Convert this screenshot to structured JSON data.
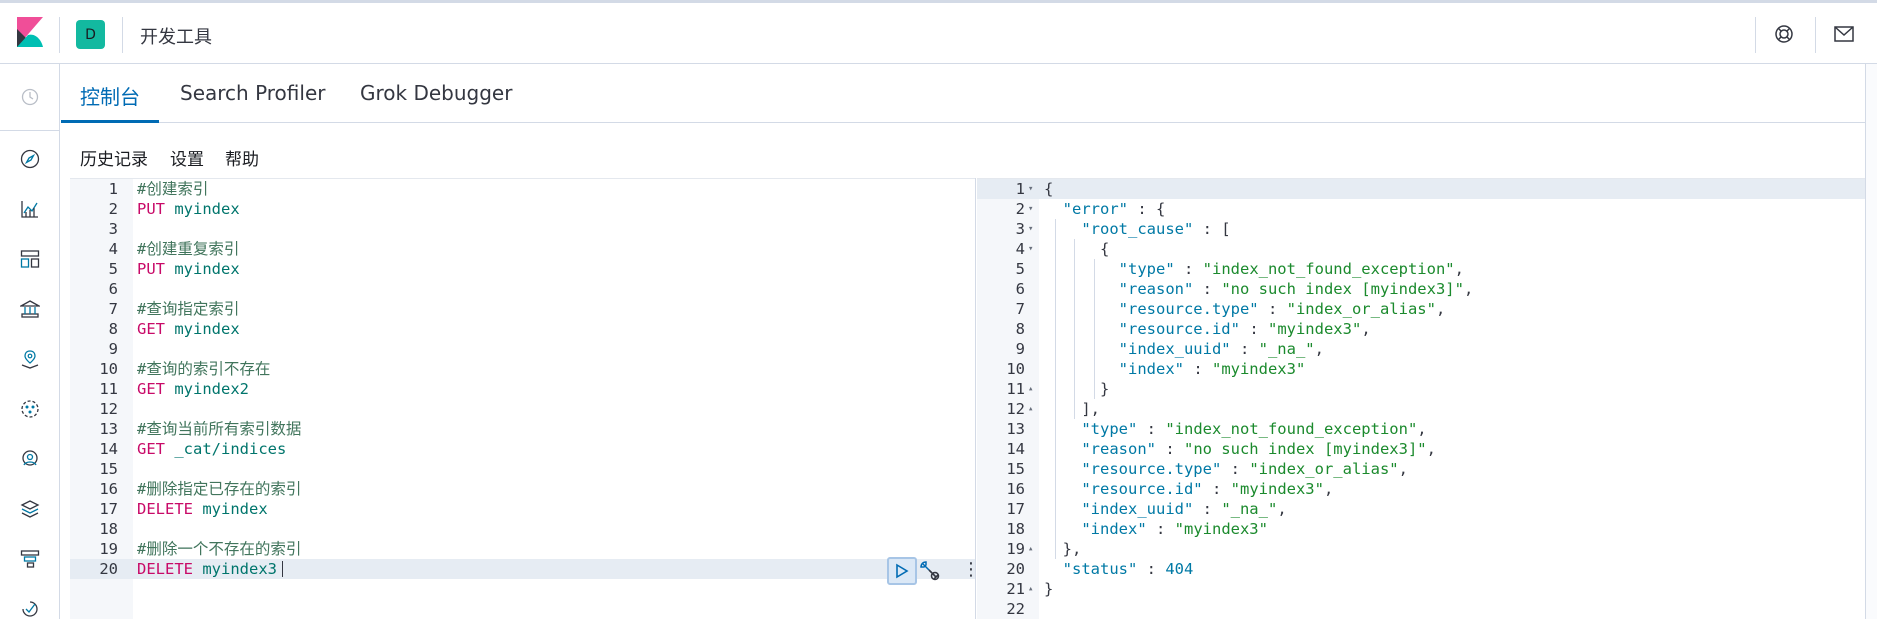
{
  "header": {
    "space_initial": "D",
    "app_title": "开发工具"
  },
  "tabs": [
    {
      "label": "控制台",
      "active": true
    },
    {
      "label": "Search Profiler",
      "active": false
    },
    {
      "label": "Grok Debugger",
      "active": false
    }
  ],
  "toolbar": {
    "history": "历史记录",
    "settings": "设置",
    "help": "帮助"
  },
  "request_editor": {
    "active_line": 20,
    "lines": [
      [
        {
          "t": "#创建索引",
          "c": "comment"
        }
      ],
      [
        {
          "t": "PUT",
          "c": "method"
        },
        {
          "t": " myindex",
          "c": "url"
        }
      ],
      [],
      [
        {
          "t": "#创建重复索引",
          "c": "comment"
        }
      ],
      [
        {
          "t": "PUT",
          "c": "method"
        },
        {
          "t": " myindex",
          "c": "url"
        }
      ],
      [],
      [
        {
          "t": "#查询指定索引",
          "c": "comment"
        }
      ],
      [
        {
          "t": "GET",
          "c": "method"
        },
        {
          "t": " myindex",
          "c": "url"
        }
      ],
      [],
      [
        {
          "t": "#查询的索引不存在",
          "c": "comment"
        }
      ],
      [
        {
          "t": "GET",
          "c": "method"
        },
        {
          "t": " myindex2",
          "c": "url"
        }
      ],
      [],
      [
        {
          "t": "#查询当前所有索引数据",
          "c": "comment"
        }
      ],
      [
        {
          "t": "GET",
          "c": "method"
        },
        {
          "t": " _cat/indices",
          "c": "url"
        }
      ],
      [],
      [
        {
          "t": "#删除指定已存在的索引",
          "c": "comment"
        }
      ],
      [
        {
          "t": "DELETE",
          "c": "method"
        },
        {
          "t": " myindex",
          "c": "url"
        }
      ],
      [],
      [
        {
          "t": "#删除一个不存在的索引",
          "c": "comment"
        }
      ],
      [
        {
          "t": "DELETE",
          "c": "method"
        },
        {
          "t": " myindex3",
          "c": "url"
        }
      ]
    ]
  },
  "response_editor": {
    "active_line": 1,
    "fold_markers": {
      "1": "▾",
      "2": "▾",
      "3": "▾",
      "4": "▾",
      "11": "▴",
      "12": "▴",
      "19": "▴",
      "21": "▴"
    },
    "lines": [
      [
        {
          "t": "{",
          "c": "punc"
        }
      ],
      [
        {
          "t": "  ",
          "c": "punc"
        },
        {
          "t": "\"error\"",
          "c": "key"
        },
        {
          "t": " : {",
          "c": "punc"
        }
      ],
      [
        {
          "t": "    ",
          "c": "punc"
        },
        {
          "t": "\"root_cause\"",
          "c": "key"
        },
        {
          "t": " : [",
          "c": "punc"
        }
      ],
      [
        {
          "t": "      {",
          "c": "punc"
        }
      ],
      [
        {
          "t": "        ",
          "c": "punc"
        },
        {
          "t": "\"type\"",
          "c": "key"
        },
        {
          "t": " : ",
          "c": "punc"
        },
        {
          "t": "\"index_not_found_exception\"",
          "c": "str"
        },
        {
          "t": ",",
          "c": "punc"
        }
      ],
      [
        {
          "t": "        ",
          "c": "punc"
        },
        {
          "t": "\"reason\"",
          "c": "key"
        },
        {
          "t": " : ",
          "c": "punc"
        },
        {
          "t": "\"no such index [myindex3]\"",
          "c": "str"
        },
        {
          "t": ",",
          "c": "punc"
        }
      ],
      [
        {
          "t": "        ",
          "c": "punc"
        },
        {
          "t": "\"resource.type\"",
          "c": "key"
        },
        {
          "t": " : ",
          "c": "punc"
        },
        {
          "t": "\"index_or_alias\"",
          "c": "str"
        },
        {
          "t": ",",
          "c": "punc"
        }
      ],
      [
        {
          "t": "        ",
          "c": "punc"
        },
        {
          "t": "\"resource.id\"",
          "c": "key"
        },
        {
          "t": " : ",
          "c": "punc"
        },
        {
          "t": "\"myindex3\"",
          "c": "str"
        },
        {
          "t": ",",
          "c": "punc"
        }
      ],
      [
        {
          "t": "        ",
          "c": "punc"
        },
        {
          "t": "\"index_uuid\"",
          "c": "key"
        },
        {
          "t": " : ",
          "c": "punc"
        },
        {
          "t": "\"_na_\"",
          "c": "str"
        },
        {
          "t": ",",
          "c": "punc"
        }
      ],
      [
        {
          "t": "        ",
          "c": "punc"
        },
        {
          "t": "\"index\"",
          "c": "key"
        },
        {
          "t": " : ",
          "c": "punc"
        },
        {
          "t": "\"myindex3\"",
          "c": "str"
        }
      ],
      [
        {
          "t": "      }",
          "c": "punc"
        }
      ],
      [
        {
          "t": "    ],",
          "c": "punc"
        }
      ],
      [
        {
          "t": "    ",
          "c": "punc"
        },
        {
          "t": "\"type\"",
          "c": "key"
        },
        {
          "t": " : ",
          "c": "punc"
        },
        {
          "t": "\"index_not_found_exception\"",
          "c": "str"
        },
        {
          "t": ",",
          "c": "punc"
        }
      ],
      [
        {
          "t": "    ",
          "c": "punc"
        },
        {
          "t": "\"reason\"",
          "c": "key"
        },
        {
          "t": " : ",
          "c": "punc"
        },
        {
          "t": "\"no such index [myindex3]\"",
          "c": "str"
        },
        {
          "t": ",",
          "c": "punc"
        }
      ],
      [
        {
          "t": "    ",
          "c": "punc"
        },
        {
          "t": "\"resource.type\"",
          "c": "key"
        },
        {
          "t": " : ",
          "c": "punc"
        },
        {
          "t": "\"index_or_alias\"",
          "c": "str"
        },
        {
          "t": ",",
          "c": "punc"
        }
      ],
      [
        {
          "t": "    ",
          "c": "punc"
        },
        {
          "t": "\"resource.id\"",
          "c": "key"
        },
        {
          "t": " : ",
          "c": "punc"
        },
        {
          "t": "\"myindex3\"",
          "c": "str"
        },
        {
          "t": ",",
          "c": "punc"
        }
      ],
      [
        {
          "t": "    ",
          "c": "punc"
        },
        {
          "t": "\"index_uuid\"",
          "c": "key"
        },
        {
          "t": " : ",
          "c": "punc"
        },
        {
          "t": "\"_na_\"",
          "c": "str"
        },
        {
          "t": ",",
          "c": "punc"
        }
      ],
      [
        {
          "t": "    ",
          "c": "punc"
        },
        {
          "t": "\"index\"",
          "c": "key"
        },
        {
          "t": " : ",
          "c": "punc"
        },
        {
          "t": "\"myindex3\"",
          "c": "str"
        }
      ],
      [
        {
          "t": "  },",
          "c": "punc"
        }
      ],
      [
        {
          "t": "  ",
          "c": "punc"
        },
        {
          "t": "\"status\"",
          "c": "key"
        },
        {
          "t": " : ",
          "c": "punc"
        },
        {
          "t": "404",
          "c": "num"
        }
      ],
      [
        {
          "t": "}",
          "c": "punc"
        }
      ],
      []
    ]
  }
}
